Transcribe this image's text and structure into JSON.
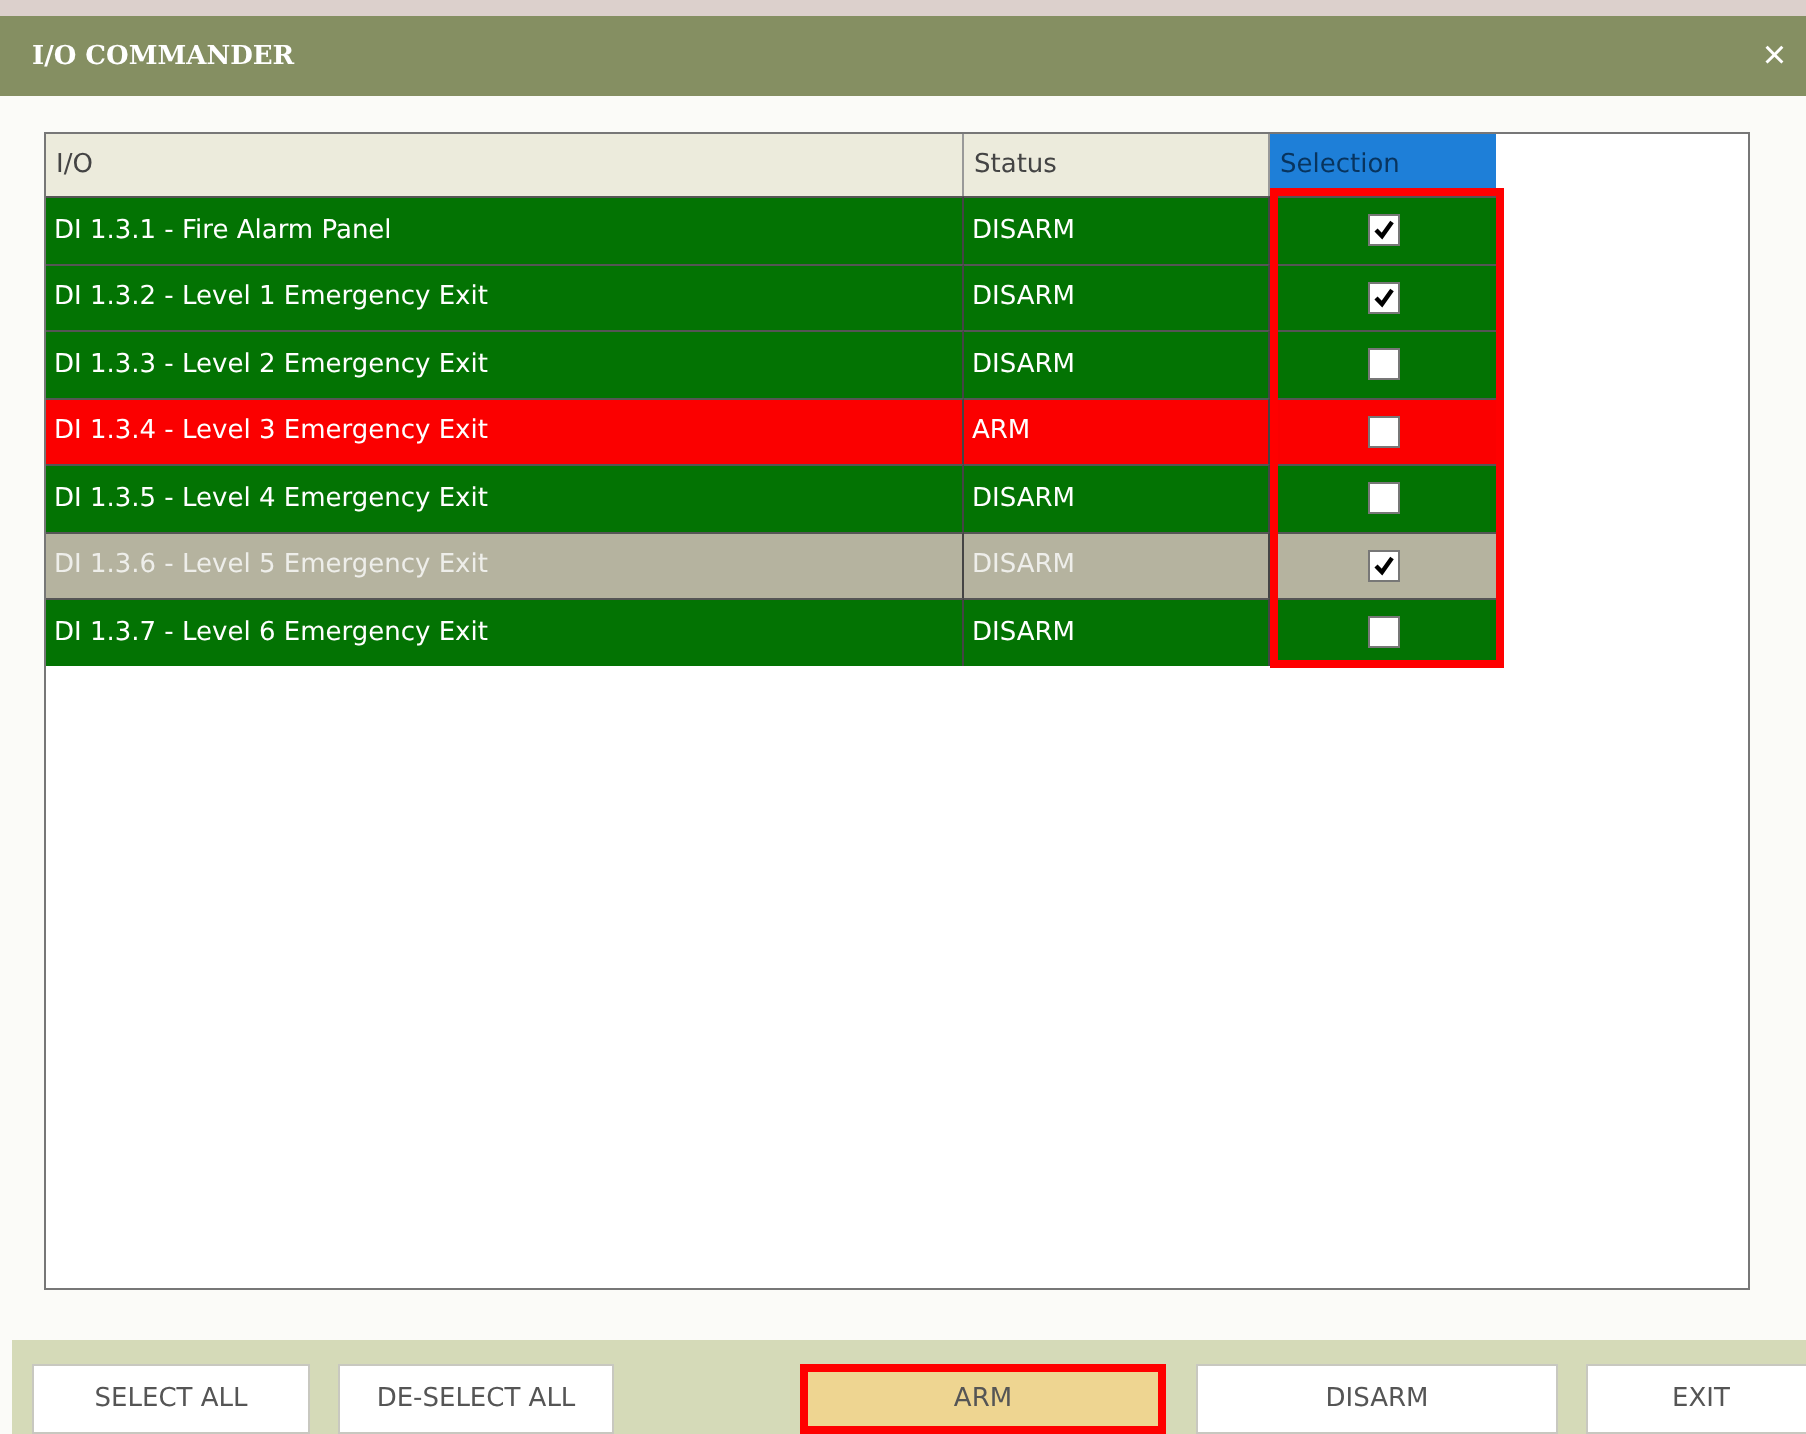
{
  "window": {
    "title": "I/O COMMANDER",
    "close": "×"
  },
  "table": {
    "columns": [
      {
        "label": "I/O",
        "highlighted": false
      },
      {
        "label": "Status",
        "highlighted": false
      },
      {
        "label": "Selection",
        "highlighted": true
      }
    ],
    "rows": [
      {
        "io": "DI 1.3.1 - Fire Alarm Panel",
        "status": "DISARM",
        "kind": "disarmed",
        "selected": false,
        "checked": true
      },
      {
        "io": "DI 1.3.2 - Level 1 Emergency Exit",
        "status": "DISARM",
        "kind": "disarmed",
        "selected": false,
        "checked": true
      },
      {
        "io": "DI 1.3.3 - Level 2 Emergency Exit",
        "status": "DISARM",
        "kind": "disarmed",
        "selected": false,
        "checked": false
      },
      {
        "io": "DI 1.3.4 - Level 3 Emergency Exit",
        "status": "ARM",
        "kind": "armed",
        "selected": false,
        "checked": false
      },
      {
        "io": "DI 1.3.5 - Level 4 Emergency Exit",
        "status": "DISARM",
        "kind": "disarmed",
        "selected": false,
        "checked": false
      },
      {
        "io": "DI 1.3.6 - Level 5 Emergency Exit",
        "status": "DISARM",
        "kind": "disarmed",
        "selected": true,
        "checked": true
      },
      {
        "io": "DI 1.3.7 - Level 6 Emergency Exit",
        "status": "DISARM",
        "kind": "disarmed",
        "selected": false,
        "checked": false
      }
    ]
  },
  "buttons": [
    {
      "label": "SELECT ALL",
      "highlighted": false
    },
    {
      "label": "DE-SELECT ALL",
      "highlighted": false
    },
    {
      "label": "ARM",
      "highlighted": true
    },
    {
      "label": "DISARM",
      "highlighted": false
    },
    {
      "label": "EXIT",
      "highlighted": false
    }
  ]
}
